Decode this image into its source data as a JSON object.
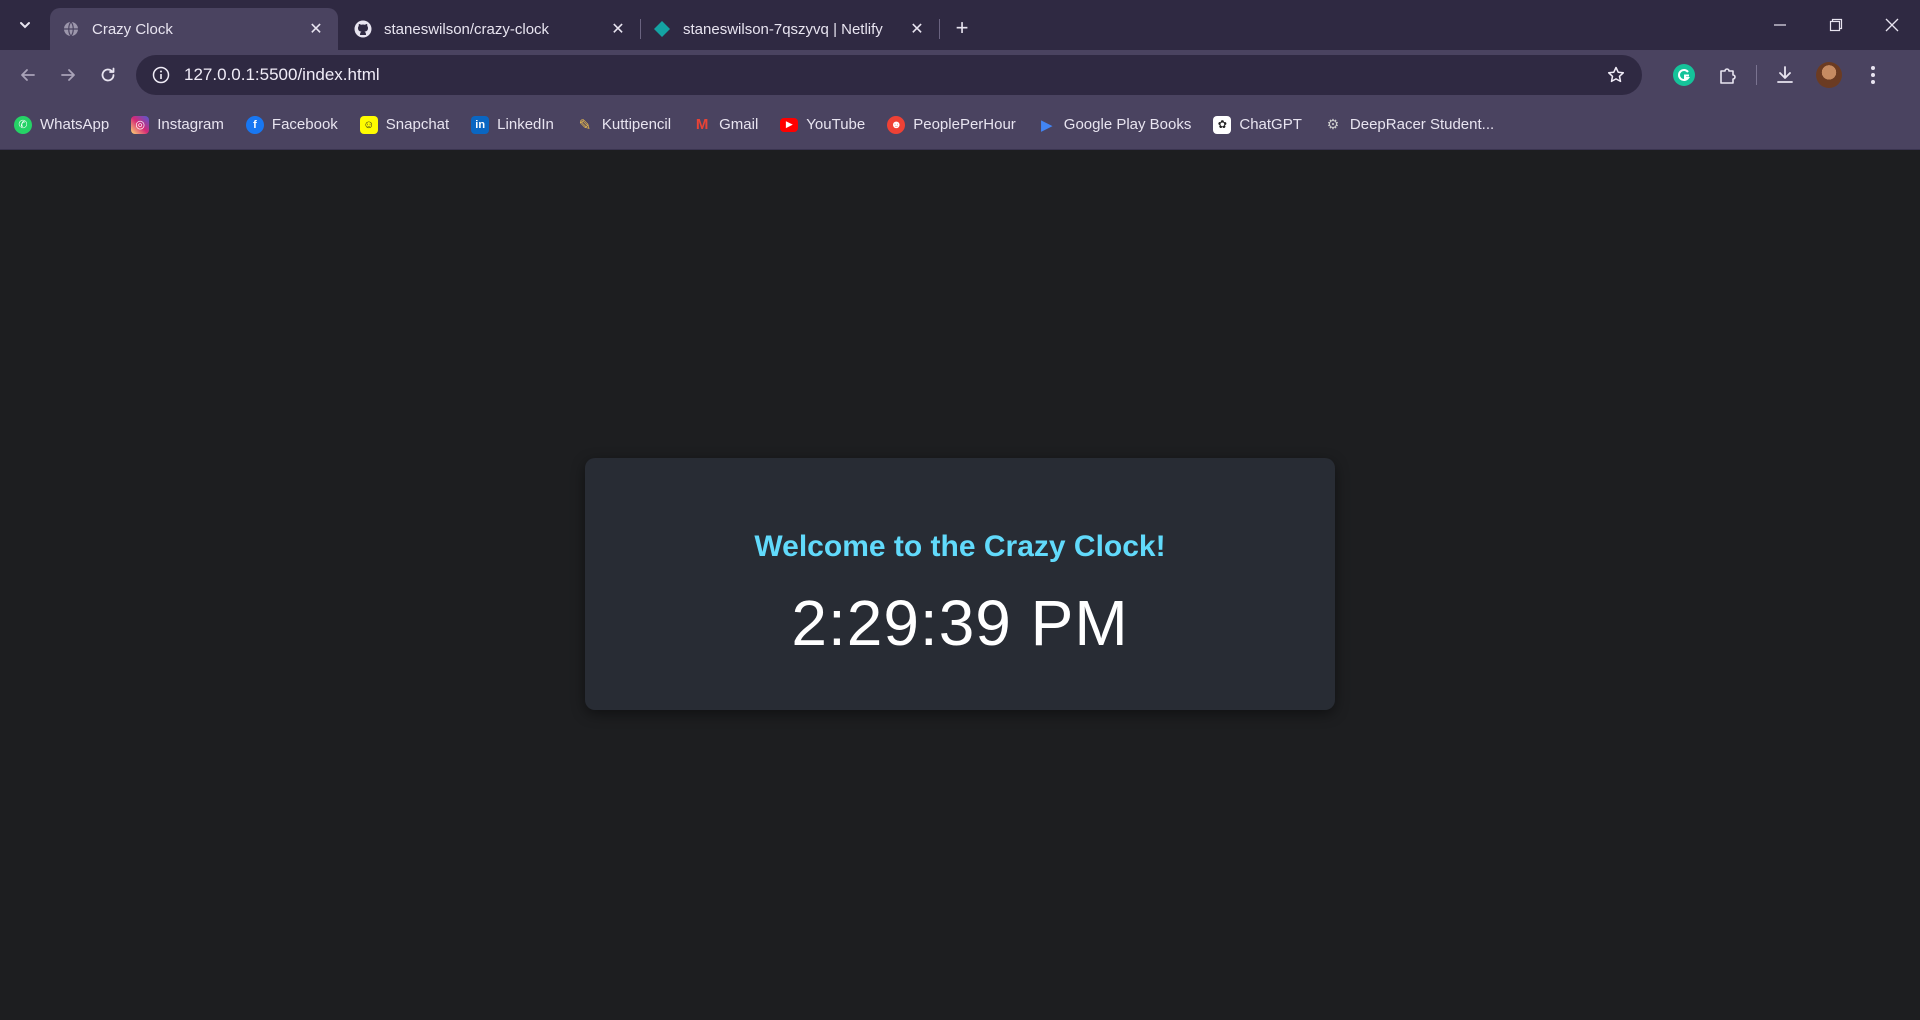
{
  "tabs": [
    {
      "title": "Crazy Clock",
      "icon": "globe-icon",
      "active": true
    },
    {
      "title": "staneswilson/crazy-clock",
      "icon": "github-icon",
      "active": false
    },
    {
      "title": "staneswilson-7qszyvq | Netlify",
      "icon": "netlify-icon",
      "active": false
    }
  ],
  "omnibox": {
    "url": "127.0.0.1:5500/index.html"
  },
  "bookmarks": [
    {
      "label": "WhatsApp",
      "icon": "whatsapp-icon",
      "color": "#25d366"
    },
    {
      "label": "Instagram",
      "icon": "instagram-icon",
      "color": "#e1306c"
    },
    {
      "label": "Facebook",
      "icon": "facebook-icon",
      "color": "#1877f2"
    },
    {
      "label": "Snapchat",
      "icon": "snapchat-icon",
      "color": "#fffc00"
    },
    {
      "label": "LinkedIn",
      "icon": "linkedin-icon",
      "color": "#0a66c2"
    },
    {
      "label": "Kuttipencil",
      "icon": "pencil-icon",
      "color": "#f2c14e"
    },
    {
      "label": "Gmail",
      "icon": "gmail-icon",
      "color": "#ea4335"
    },
    {
      "label": "YouTube",
      "icon": "youtube-icon",
      "color": "#ff0000"
    },
    {
      "label": "PeoplePerHour",
      "icon": "peopleperhour-icon",
      "color": "#ef4135"
    },
    {
      "label": "Google Play Books",
      "icon": "play-books-icon",
      "color": "#4285f4"
    },
    {
      "label": "ChatGPT",
      "icon": "chatgpt-icon",
      "color": "#ffffff"
    },
    {
      "label": "DeepRacer Student...",
      "icon": "deepracer-icon",
      "color": "#cccccc"
    }
  ],
  "page": {
    "heading": "Welcome to the Crazy Clock!",
    "time": "2:29:39 PM"
  },
  "colors": {
    "accent": "#61dafb",
    "card_bg": "#282c34",
    "page_bg": "#1d1e20",
    "chrome_bg": "#2f2942",
    "toolbar_bg": "#4a4360"
  }
}
